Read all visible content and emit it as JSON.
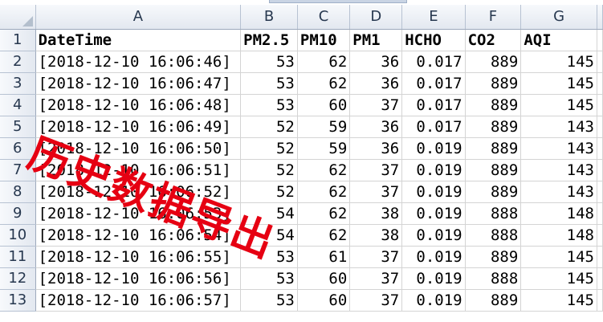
{
  "sheet": {
    "columns": [
      "A",
      "B",
      "C",
      "D",
      "E",
      "F",
      "G"
    ],
    "rows": [
      {
        "num": "1",
        "cells": [
          "DateTime",
          "PM2.5",
          "PM10",
          "PM1",
          "HCHO",
          "CO2",
          "AQI"
        ]
      },
      {
        "num": "2",
        "cells": [
          "[2018-12-10 16:06:46]",
          "53",
          "62",
          "36",
          "0.017",
          "889",
          "145"
        ]
      },
      {
        "num": "3",
        "cells": [
          "[2018-12-10 16:06:47]",
          "53",
          "62",
          "36",
          "0.017",
          "889",
          "145"
        ]
      },
      {
        "num": "4",
        "cells": [
          "[2018-12-10 16:06:48]",
          "53",
          "60",
          "37",
          "0.017",
          "889",
          "145"
        ]
      },
      {
        "num": "5",
        "cells": [
          "[2018-12-10 16:06:49]",
          "52",
          "59",
          "36",
          "0.017",
          "889",
          "143"
        ]
      },
      {
        "num": "6",
        "cells": [
          "[2018-12-10 16:06:50]",
          "52",
          "59",
          "36",
          "0.019",
          "889",
          "143"
        ]
      },
      {
        "num": "7",
        "cells": [
          "[2018-12-10 16:06:51]",
          "52",
          "62",
          "37",
          "0.019",
          "889",
          "143"
        ]
      },
      {
        "num": "8",
        "cells": [
          "[2018-12-10 16:06:52]",
          "52",
          "62",
          "37",
          "0.019",
          "889",
          "143"
        ]
      },
      {
        "num": "9",
        "cells": [
          "[2018-12-10 16:06:53]",
          "54",
          "62",
          "38",
          "0.019",
          "888",
          "148"
        ]
      },
      {
        "num": "10",
        "cells": [
          "[2018-12-10 16:06:54]",
          "54",
          "62",
          "38",
          "0.019",
          "888",
          "148"
        ]
      },
      {
        "num": "11",
        "cells": [
          "[2018-12-10 16:06:55]",
          "53",
          "61",
          "37",
          "0.019",
          "889",
          "145"
        ]
      },
      {
        "num": "12",
        "cells": [
          "[2018-12-10 16:06:56]",
          "53",
          "60",
          "37",
          "0.019",
          "888",
          "145"
        ]
      },
      {
        "num": "13",
        "cells": [
          "[2018-12-10 16:06:57]",
          "53",
          "60",
          "37",
          "0.019",
          "889",
          "145"
        ]
      }
    ]
  },
  "watermark": {
    "text": "历史数据导出",
    "color": "#e60012"
  }
}
